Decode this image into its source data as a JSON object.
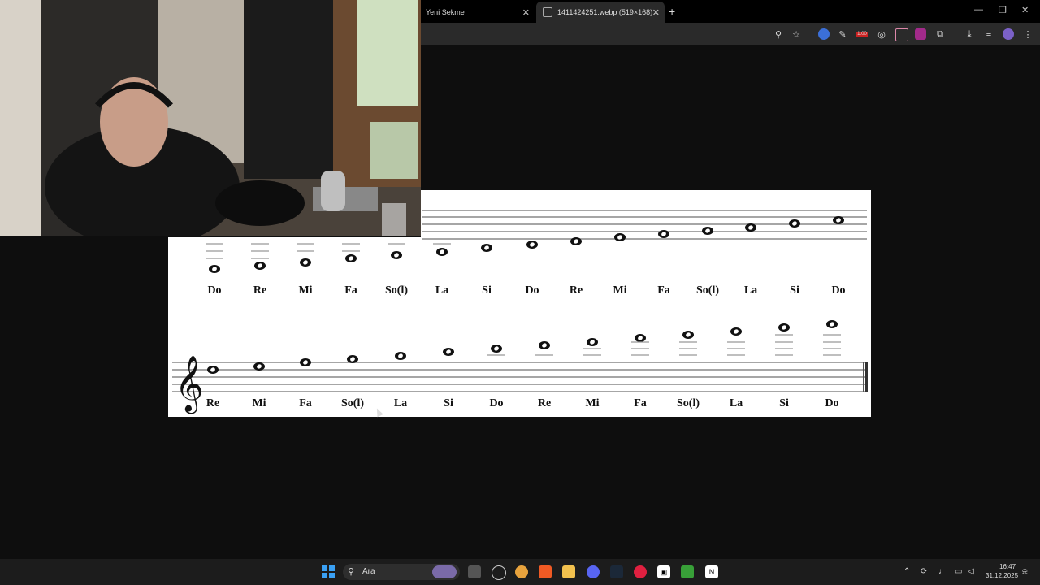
{
  "browser": {
    "tabs": [
      {
        "label": "Yeni Sekme"
      },
      {
        "label": "1411424251.webp (519×168)"
      }
    ],
    "new_tab_symbol": "+",
    "close_symbol": "✕",
    "window_controls": {
      "minimize": "—",
      "maximize": "❐",
      "close": "✕"
    },
    "badge_text": "1.00"
  },
  "sheet": {
    "staff1_names": [
      "Do",
      "Re",
      "Mi",
      "Fa",
      "So(l)",
      "La",
      "Si",
      "Do",
      "Re",
      "Mi",
      "Fa",
      "So(l)",
      "La",
      "Si",
      "Do"
    ],
    "staff2_names": [
      "Re",
      "Mi",
      "Fa",
      "So(l)",
      "La",
      "Si",
      "Do",
      "Re",
      "Mi",
      "Fa",
      "So(l)",
      "La",
      "Si",
      "Do"
    ],
    "clef_symbol": "𝄞"
  },
  "taskbar": {
    "search_placeholder": "Ara",
    "clock_time": "16:47",
    "clock_date": "31.12.2025"
  },
  "colors": {
    "background": "#0e0e0e",
    "tab_active": "#2a2a2a",
    "taskbar": "#1c1c1c",
    "windows_blue": "#0078d4"
  }
}
